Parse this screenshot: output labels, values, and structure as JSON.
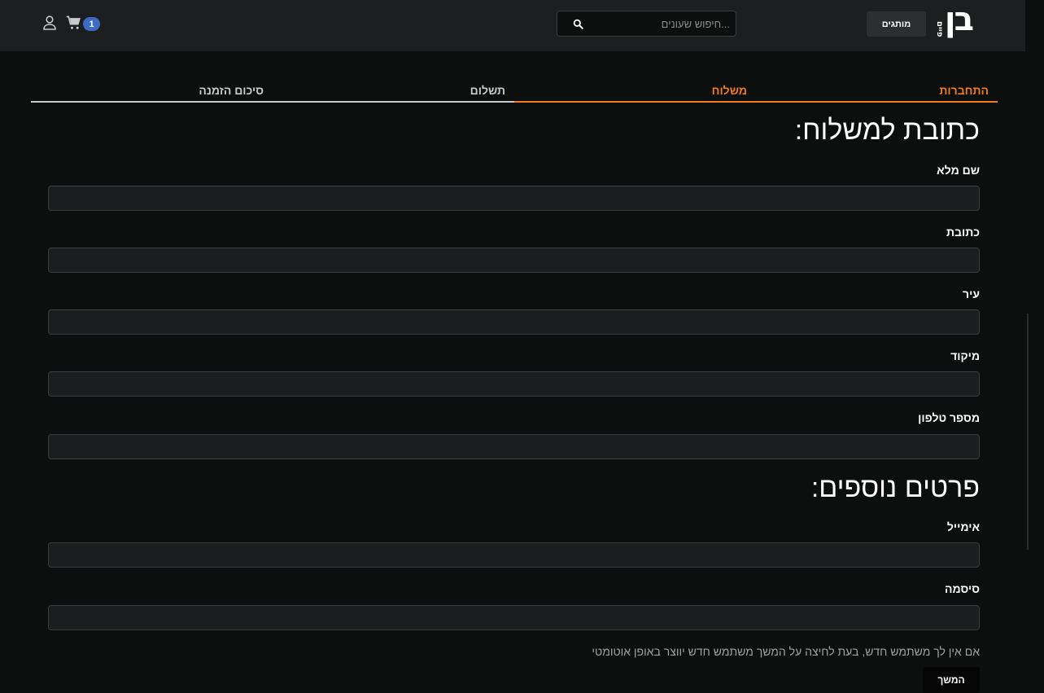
{
  "header": {
    "logo_main": "בן",
    "logo_sub": "פיים",
    "brands_label": "מותגים",
    "search": {
      "placeholder": "...חיפוש שעונים",
      "value": ""
    },
    "cart_count": "1"
  },
  "steps": [
    {
      "label": "התחברות",
      "state": "active"
    },
    {
      "label": "משלוח",
      "state": "active"
    },
    {
      "label": "תשלום",
      "state": "inactive"
    },
    {
      "label": "סיכום הזמנה",
      "state": "inactive"
    }
  ],
  "shipping": {
    "title": "כתובת למשלוח:",
    "fields": [
      {
        "label": "שם מלא",
        "value": ""
      },
      {
        "label": "כתובת",
        "value": ""
      },
      {
        "label": "עיר",
        "value": ""
      },
      {
        "label": "מיקוד",
        "value": ""
      },
      {
        "label": "מספר טלפון",
        "value": ""
      }
    ]
  },
  "extra": {
    "title": "פרטים נוספים:",
    "fields": [
      {
        "label": "אימייל",
        "value": ""
      },
      {
        "label": "סיסמה",
        "value": ""
      }
    ]
  },
  "note": "אם אין לך משתמש חדש, בעת לחיצה על המשך משתמש חדש יווצר באופן אוטומטי",
  "continue_label": "המשך",
  "colors": {
    "accent": "#f07c1e",
    "badge": "#3c6bc4",
    "background": "#0d0e0e",
    "header": "#1d1e1f"
  }
}
